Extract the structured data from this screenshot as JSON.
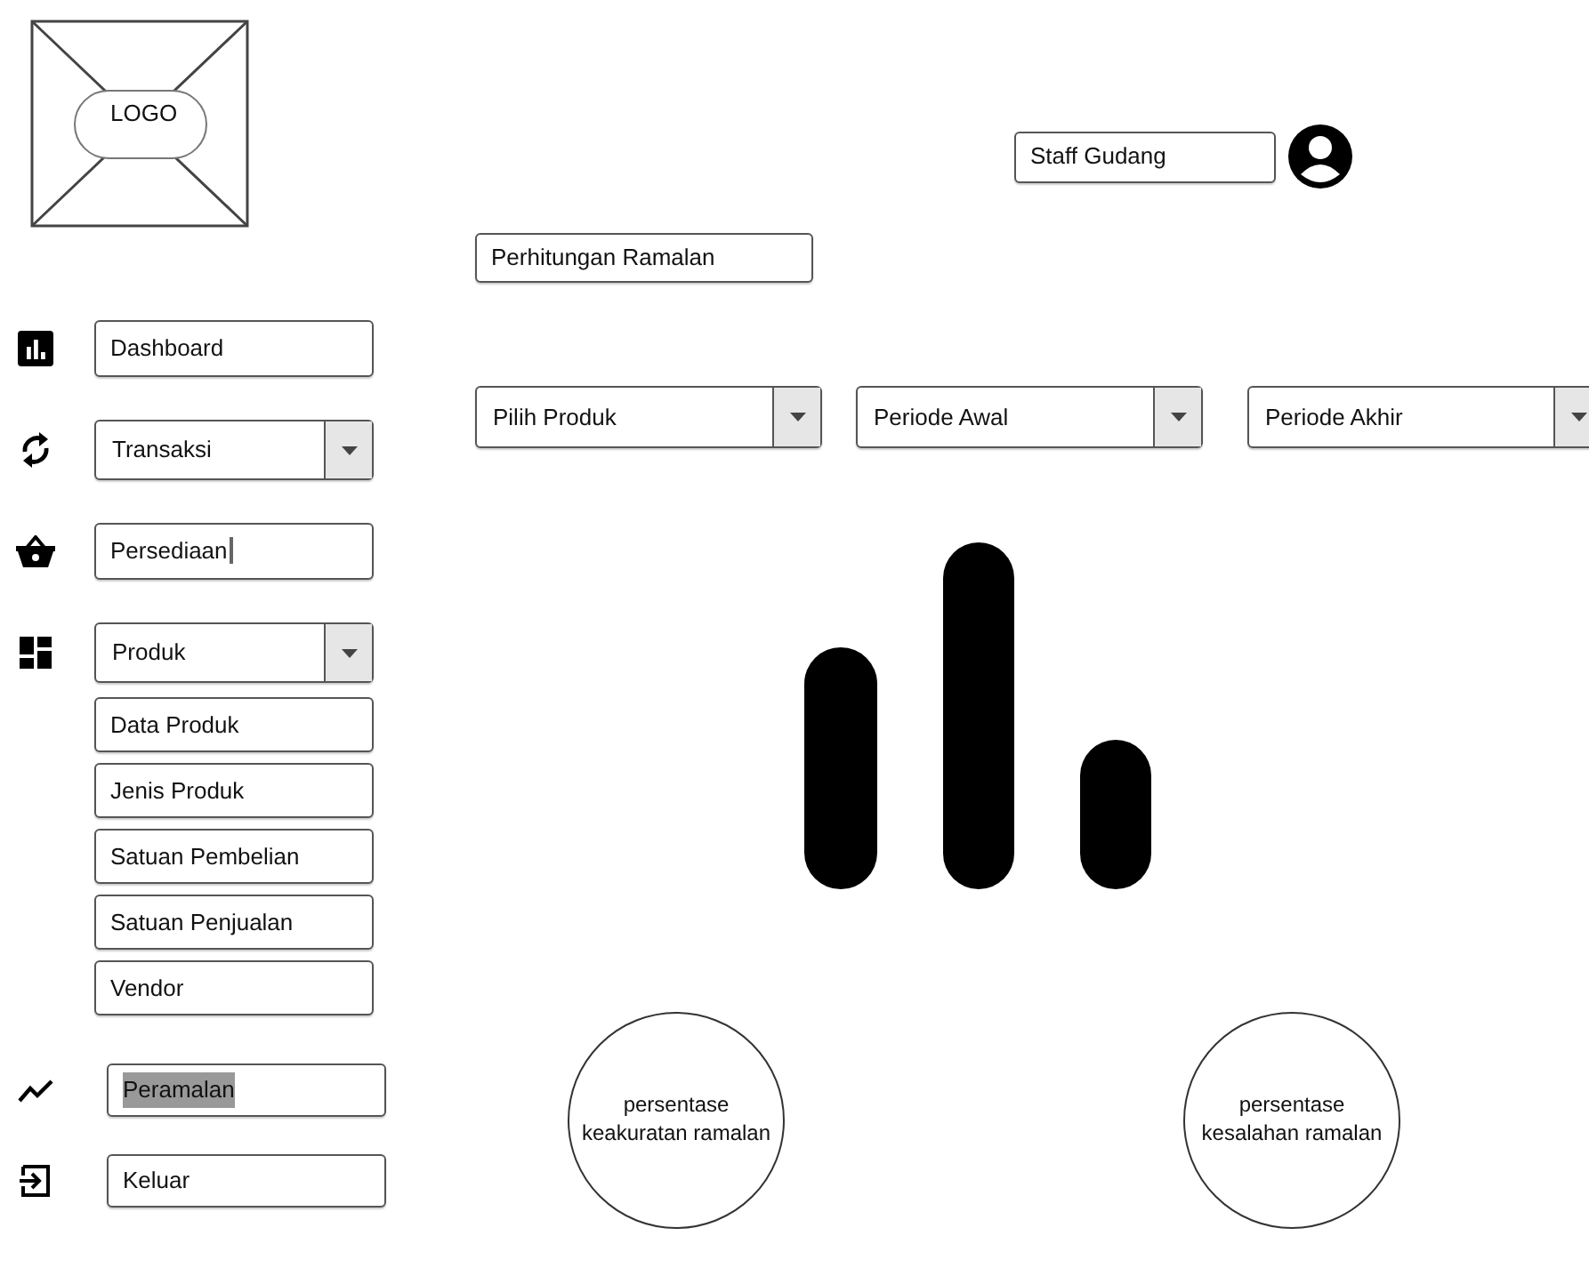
{
  "logo": {
    "label": "LOGO"
  },
  "sidebar": {
    "items": [
      {
        "label": "Dashboard",
        "kind": "field",
        "focused": false
      },
      {
        "label": "Transaksi",
        "kind": "dropdown",
        "focused": false
      },
      {
        "label": "Persediaan",
        "kind": "field",
        "focused": true
      },
      {
        "label": "Produk",
        "kind": "dropdown",
        "focused": false,
        "children": [
          {
            "label": "Data Produk"
          },
          {
            "label": "Jenis Produk"
          },
          {
            "label": "Satuan Pembelian"
          },
          {
            "label": "Satuan Penjualan"
          },
          {
            "label": "Vendor"
          }
        ]
      }
    ],
    "bottom_items": [
      {
        "label": "Peramalan",
        "selected": true
      },
      {
        "label": "Keluar",
        "selected": false
      }
    ]
  },
  "user": {
    "role": "Staff Gudang"
  },
  "page_title": "Perhitungan Ramalan",
  "filters": [
    {
      "label": "Pilih Produk"
    },
    {
      "label": "Periode Awal"
    },
    {
      "label": "Periode Akhir"
    }
  ],
  "indicators": [
    {
      "label": "persentase keakuratan ramalan"
    },
    {
      "label": "persentase kesalahan ramalan"
    }
  ]
}
